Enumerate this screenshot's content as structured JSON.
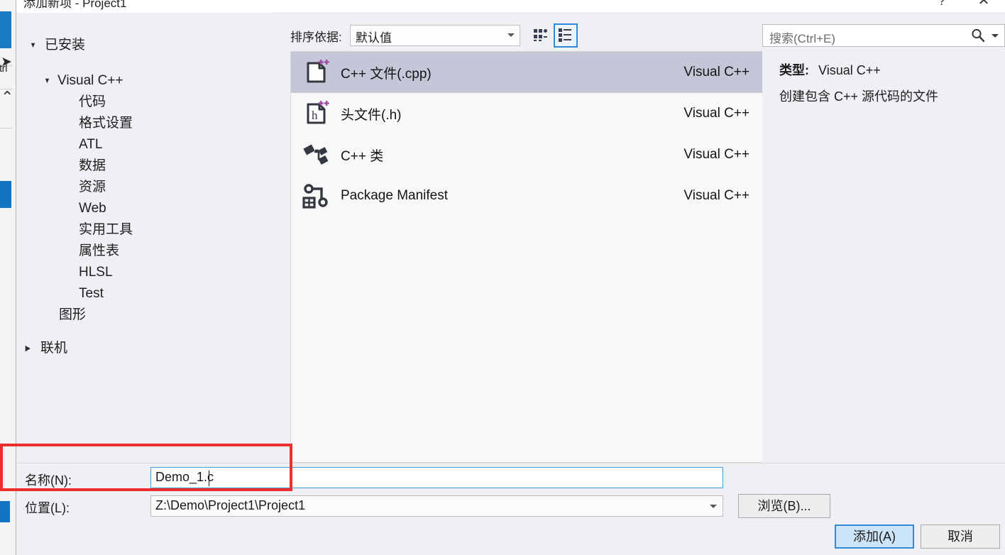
{
  "window": {
    "title": "添加新项 - Project1",
    "help_icon": "?",
    "close_icon": "✕"
  },
  "sidebar": {
    "root_label": "已安装",
    "root_caret": "expanded",
    "groups": [
      {
        "label": "Visual C++",
        "selected": true,
        "caret": "expanded",
        "children": [
          "代码",
          "格式设置",
          "ATL",
          "数据",
          "资源",
          "Web",
          "实用工具",
          "属性表",
          "HLSL",
          "Test"
        ]
      }
    ],
    "standalone_child": "图形",
    "online_label": "联机",
    "online_caret": "collapsed"
  },
  "toolbar": {
    "sort_label": "排序依据:",
    "sort_value": "默认值",
    "grid_view_icon": "grid-view-icon",
    "list_view_icon": "list-view-icon",
    "list_view_selected": true
  },
  "search": {
    "placeholder": "搜索(Ctrl+E)",
    "icon": "search-icon",
    "dropdown_icon": "chevron-down-icon"
  },
  "templates": {
    "items": [
      {
        "name": "C++ 文件(.cpp)",
        "category": "Visual C++",
        "icon": "cpp-file-icon",
        "selected": true
      },
      {
        "name": "头文件(.h)",
        "category": "Visual C++",
        "icon": "header-file-icon",
        "selected": false
      },
      {
        "name": "C++ 类",
        "category": "Visual C++",
        "icon": "cpp-class-icon",
        "selected": false
      },
      {
        "name": "Package Manifest",
        "category": "Visual C++",
        "icon": "package-manifest-icon",
        "selected": false
      }
    ]
  },
  "details": {
    "type_label": "类型:",
    "type_value": "Visual C++",
    "description": "创建包含 C++ 源代码的文件"
  },
  "form": {
    "name_label": "名称(N):",
    "name_value": "Demo_1.c",
    "location_label": "位置(L):",
    "location_value": "Z:\\Demo\\Project1\\Project1"
  },
  "buttons": {
    "browse": "浏览(B)...",
    "add": "添加(A)",
    "cancel": "取消"
  },
  "colors": {
    "dialog_bg": "#eef0f4",
    "selection": "#c5c7d8",
    "tree_selection": "#cbcfd8",
    "accent_blue": "#2f8ada",
    "annotation_red": "#ee2d2d",
    "icon_purple": "#9b4f9e"
  }
}
